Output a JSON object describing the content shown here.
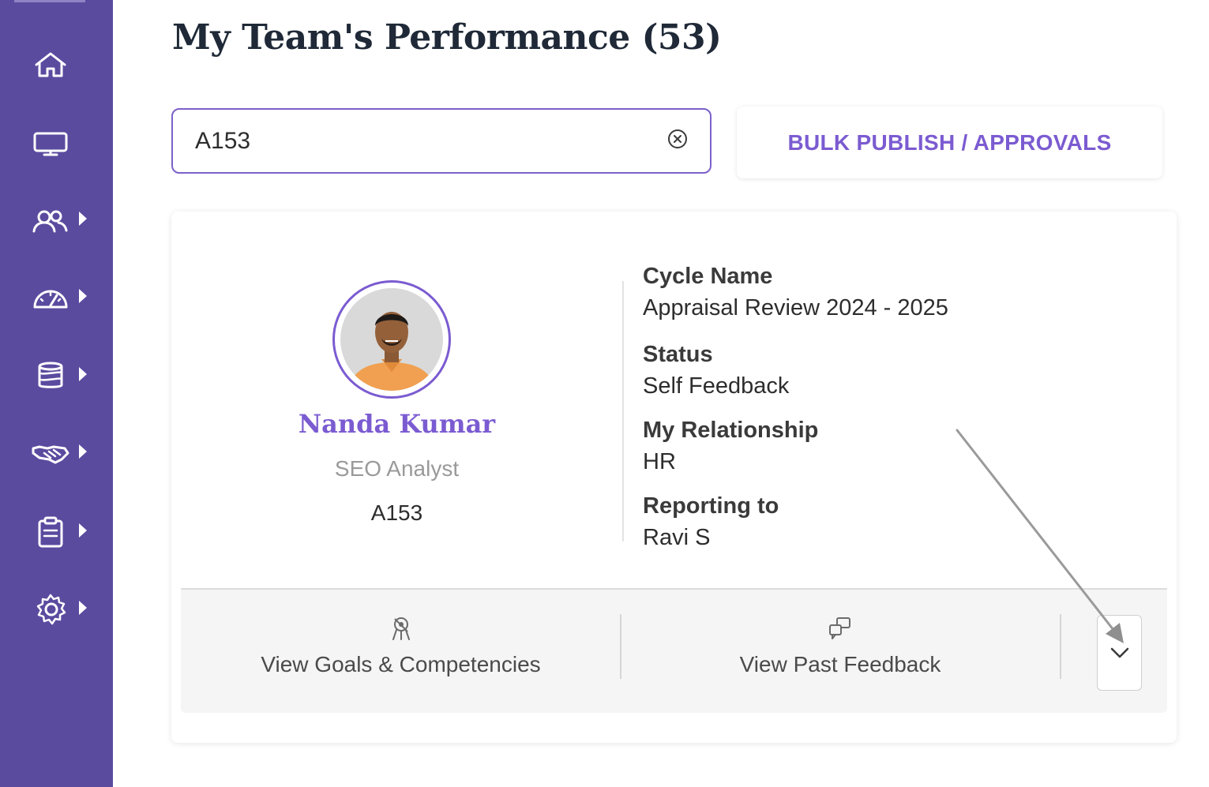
{
  "page": {
    "title": "My Team's Performance (53)"
  },
  "sidebar": {
    "items": [
      {
        "icon": "home-icon"
      },
      {
        "icon": "monitor-icon"
      },
      {
        "icon": "team-icon",
        "has_submenu": true
      },
      {
        "icon": "dashboard-gauge-icon",
        "has_submenu": true
      },
      {
        "icon": "database-icon",
        "has_submenu": true
      },
      {
        "icon": "handshake-icon",
        "has_submenu": true
      },
      {
        "icon": "clipboard-icon",
        "has_submenu": true
      },
      {
        "icon": "settings-icon",
        "has_submenu": true
      }
    ],
    "background": "#5b4b9f"
  },
  "search": {
    "value": "A153",
    "clear_icon": "clear-circle-icon"
  },
  "toolbar": {
    "bulk_label": "BULK PUBLISH / APPROVALS"
  },
  "employee": {
    "name": "Nanda Kumar",
    "role": "SEO Analyst",
    "id": "A153",
    "details": {
      "cycle_label": "Cycle Name",
      "cycle_value": "Appraisal Review 2024 - 2025",
      "status_label": "Status",
      "status_value": "Self Feedback",
      "relationship_label": "My Relationship",
      "relationship_value": "HR",
      "reporting_label": "Reporting to",
      "reporting_value": "Ravi S"
    }
  },
  "actions": {
    "goals_label": "View Goals & Competencies",
    "goals_icon": "goals-icon",
    "feedback_label": "View Past Feedback",
    "feedback_icon": "feedback-icon",
    "expand_icon": "chevron-down-icon"
  },
  "colors": {
    "accent": "#7b5bd1",
    "sidebar": "#5b4b9f"
  }
}
